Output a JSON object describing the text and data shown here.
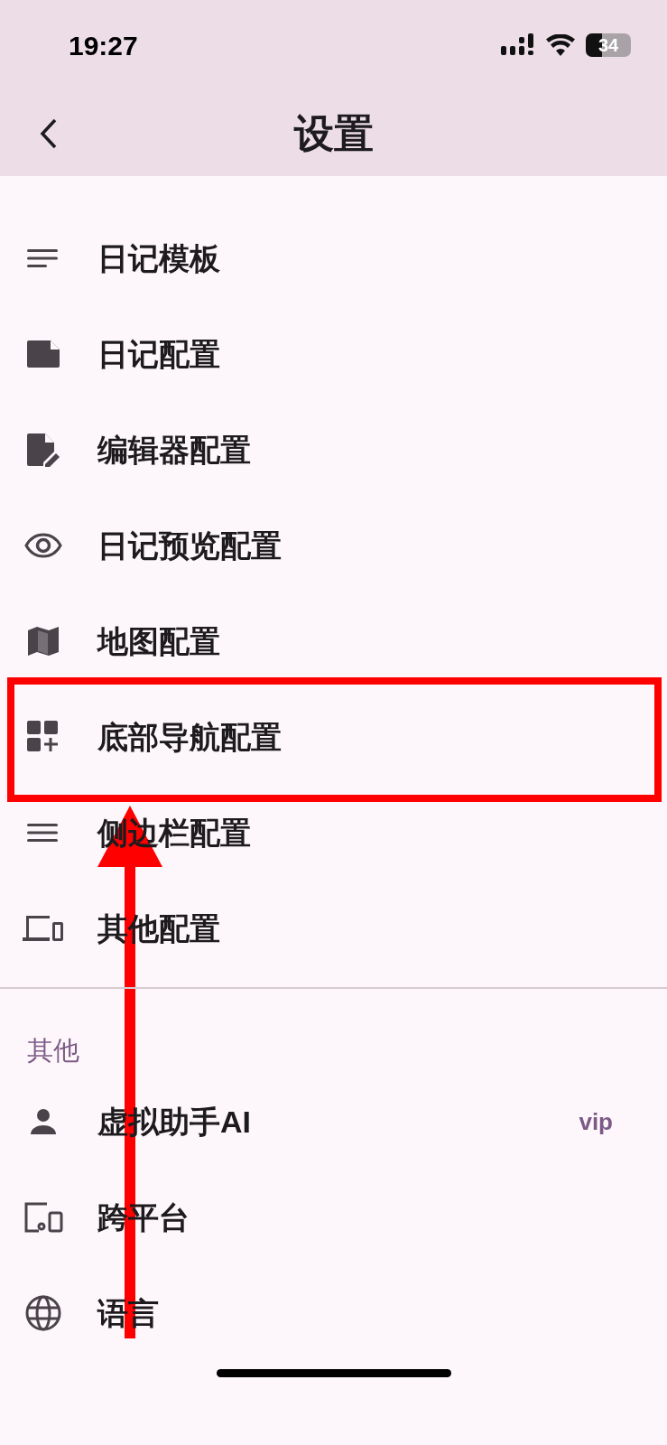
{
  "status_bar": {
    "time": "19:27",
    "battery": "34"
  },
  "header": {
    "title": "设置"
  },
  "sections": [
    {
      "items": [
        {
          "label": "日记模板"
        },
        {
          "label": "日记配置"
        },
        {
          "label": "编辑器配置"
        },
        {
          "label": "日记预览配置"
        },
        {
          "label": "地图配置"
        },
        {
          "label": "底部导航配置"
        },
        {
          "label": "侧边栏配置"
        },
        {
          "label": "其他配置"
        }
      ]
    },
    {
      "title": "其他",
      "items": [
        {
          "label": "虚拟助手AI",
          "badge": "vip"
        },
        {
          "label": "跨平台"
        },
        {
          "label": "语言"
        }
      ]
    }
  ]
}
